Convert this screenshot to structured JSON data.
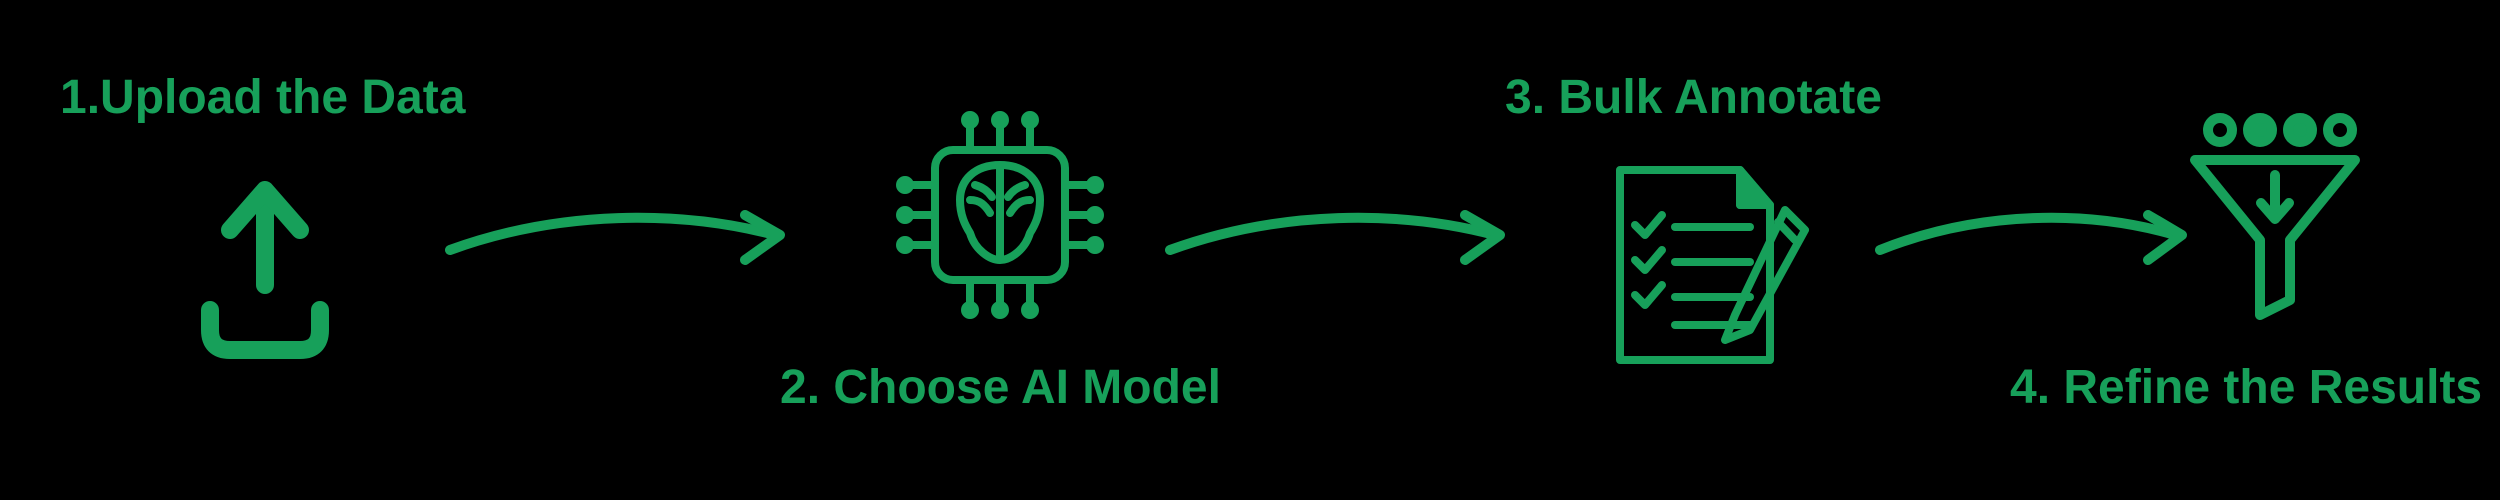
{
  "accent_color": "#17A05A",
  "steps": {
    "s1": {
      "label": "1.Upload the Data",
      "icon": "upload-icon"
    },
    "s2": {
      "label": "2. Choose AI Model",
      "icon": "ai-chip-brain-icon"
    },
    "s3": {
      "label": "3. Bulk Annotate",
      "icon": "annotate-document-icon"
    },
    "s4": {
      "label": "4. Refine the Results",
      "icon": "funnel-filter-icon"
    }
  },
  "flow": [
    {
      "from": "s1",
      "to": "s2",
      "icon": "arrow-right-icon"
    },
    {
      "from": "s2",
      "to": "s3",
      "icon": "arrow-right-icon"
    },
    {
      "from": "s3",
      "to": "s4",
      "icon": "arrow-right-icon"
    }
  ]
}
